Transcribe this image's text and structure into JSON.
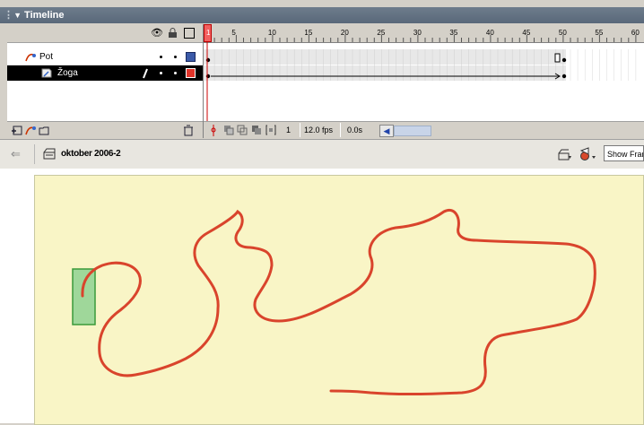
{
  "timeline": {
    "title": "Timeline",
    "frame_numbers": [
      "1",
      "5",
      "10",
      "15",
      "20",
      "25",
      "30",
      "35",
      "40",
      "45",
      "50",
      "55",
      "60"
    ],
    "layers": [
      {
        "name": "Pot",
        "type": "guide"
      },
      {
        "name": "Žoga",
        "type": "guided",
        "selected": true
      }
    ],
    "status": {
      "current_frame": "1",
      "frame_rate": "12.0 fps",
      "elapsed": "0.0s"
    },
    "colors": {
      "playhead": "#cc0000",
      "selected_row": "#000000",
      "swatch_pot": "#3b5aa8",
      "swatch_zoga": "#e0342a"
    }
  },
  "editbar": {
    "scene_title": "oktober 2006-2",
    "view_select": "Show Fran"
  },
  "stage": {
    "background": "#f9f5c6",
    "path_color": "#d9442c",
    "symbol_fill": "#9fd79a",
    "symbol_stroke": "#3a9a3a"
  }
}
